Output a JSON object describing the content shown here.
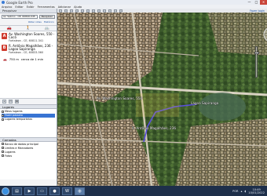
{
  "window": {
    "title": "Google Earth Pro",
    "close_glyph": "✕",
    "min_glyph": "—",
    "max_glyph": "□"
  },
  "menu": [
    "Arquivo",
    "Editar",
    "Exibir",
    "Ferramentas",
    "Adicionar",
    "Ajuda"
  ],
  "search": {
    "panel_title": "Pesquisar",
    "input_value": "Av. Sabino - CE, 60840-045",
    "button_label": "Pesquisar",
    "link_history": "Histórico",
    "link_options": "Obter rotas"
  },
  "route": {
    "a": {
      "marker": "A",
      "title": "Av. Washington Soares, 550 - Cocó",
      "sub": "Fortaleza - CE, 60811-341"
    },
    "b": {
      "marker": "B",
      "title": "R. Antônio Magalhães, 236 - Lagoa Sapiranga",
      "sub": "Fortaleza - CE, 60833-560"
    },
    "distance": "750 m",
    "duration": "cerca de 1 min",
    "icon": "car-icon"
  },
  "places": {
    "panel_title": "Lugares",
    "items": [
      {
        "label": "Meus lugares",
        "selected": false
      },
      {
        "label": "Fazer passeio",
        "selected": true
      },
      {
        "label": "Lugares temporários",
        "selected": false
      }
    ]
  },
  "layers": {
    "panel_title": "Camadas",
    "items": [
      {
        "label": "Banco de dados principal"
      },
      {
        "label": "Limites e Marcadores"
      },
      {
        "label": "Lugares"
      },
      {
        "label": "Fotos"
      }
    ]
  },
  "map": {
    "signin": "Fazer login",
    "labels": [
      {
        "text": "Av. Washington Soares, 550"
      },
      {
        "text": "R. Antônio Magalhães, 236"
      },
      {
        "text": "Lagoa Sapiranga"
      }
    ]
  },
  "taskbar": {
    "time": "10:49",
    "date": "10/01/2022",
    "lang": "POR"
  }
}
